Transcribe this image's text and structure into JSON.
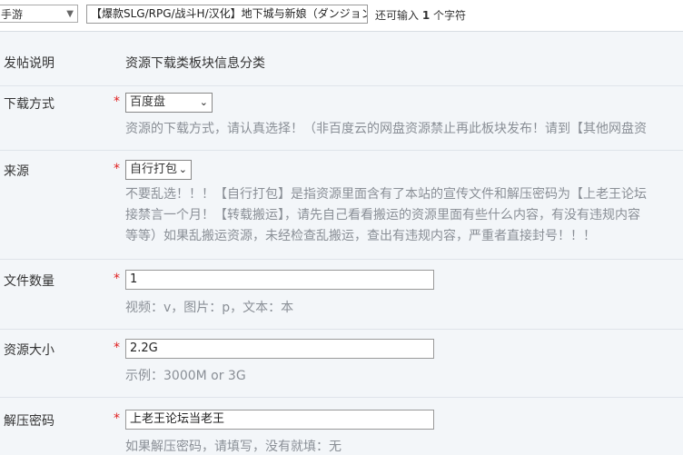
{
  "topbar": {
    "type_value": "手游",
    "title_value": "【爆款SLG/RPG/战斗H/汉化】地下城与新娘（ダンジョン",
    "remain_prefix": "还可输入",
    "remain_count": "1",
    "remain_suffix": "个字符"
  },
  "rows": {
    "post_info": {
      "label": "发帖说明",
      "value": "资源下载类板块信息分类"
    },
    "download": {
      "label": "下载方式",
      "required": "*",
      "selected": "百度盘",
      "hint": "资源的下载方式，请认真选择！（非百度云的网盘资源禁止再此板块发布！请到【其他网盘资"
    },
    "source": {
      "label": "来源",
      "required": "*",
      "selected": "自行打包",
      "hint_lines": [
        "不要乱选！！！【自行打包】是指资源里面含有了本站的宣传文件和解压密码为【上老王论坛",
        "接禁言一个月！【转载搬运】，请先自己看看搬运的资源里面有些什么内容，有没有违规内容",
        "等等）如果乱搬运资源，未经检查乱搬运，查出有违规内容，严重者直接封号！！！"
      ]
    },
    "file_count": {
      "label": "文件数量",
      "required": "*",
      "value": "1",
      "hint": "视频：v，图片：p，文本：本"
    },
    "size": {
      "label": "资源大小",
      "required": "*",
      "value": "2.2G",
      "hint": "示例：3000M or 3G"
    },
    "password": {
      "label": "解压密码",
      "required": "*",
      "value": "上老王论坛当老王",
      "hint": "如果解压密码，请填写，没有就填：无"
    }
  }
}
